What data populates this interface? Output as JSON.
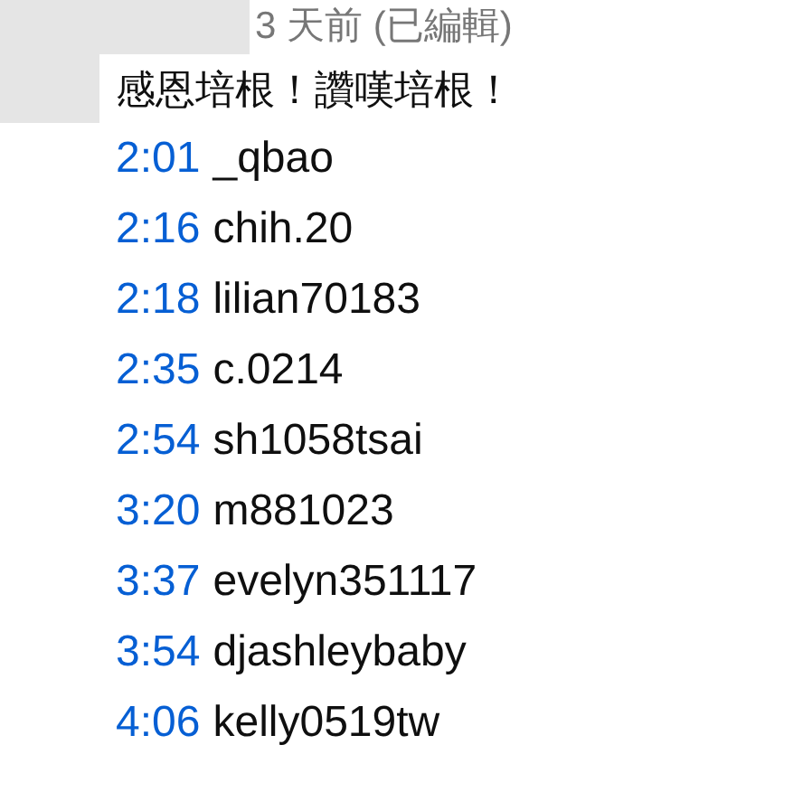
{
  "comment": {
    "time": "3 天前 (已編輯)",
    "text": "感恩培根！讚嘆培根！",
    "timestamps": [
      {
        "time": "2:01",
        "name": "_qbao"
      },
      {
        "time": "2:16",
        "name": "chih.20"
      },
      {
        "time": "2:18",
        "name": "lilian70183"
      },
      {
        "time": "2:35",
        "name": "c.0214"
      },
      {
        "time": "2:54",
        "name": "sh1058tsai"
      },
      {
        "time": "3:20",
        "name": "m881023"
      },
      {
        "time": "3:37",
        "name": "evelyn351117"
      },
      {
        "time": "3:54",
        "name": "djashleybaby"
      },
      {
        "time": "4:06",
        "name": "kelly0519tw"
      }
    ]
  }
}
